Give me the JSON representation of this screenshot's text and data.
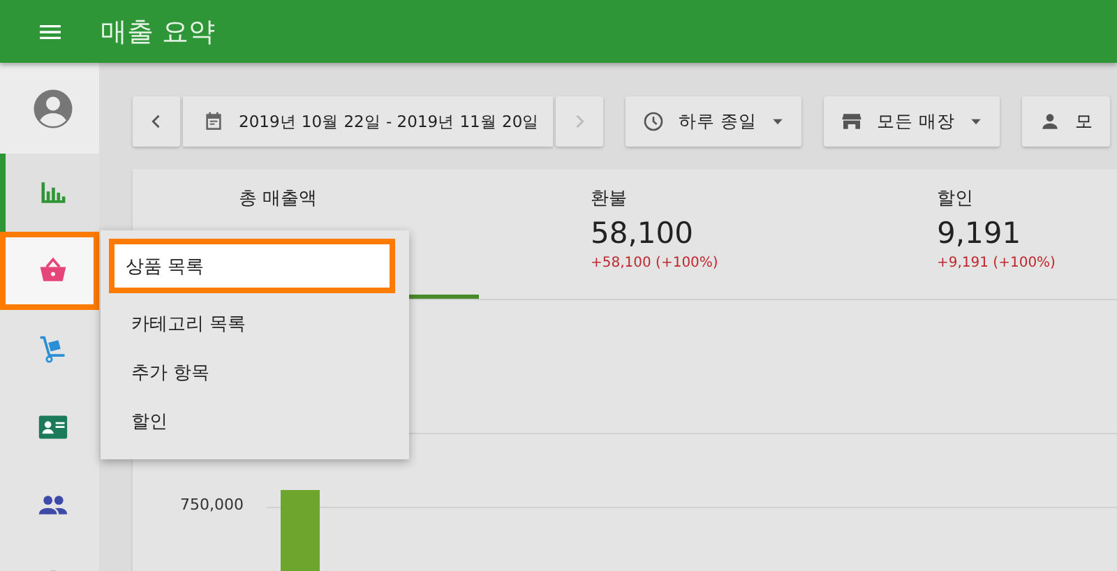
{
  "app_bar": {
    "title": "매출 요약"
  },
  "sidebar": {
    "items": [
      {
        "selected": false,
        "highlighted": false
      },
      {
        "selected": true,
        "highlighted": false
      },
      {
        "selected": false,
        "highlighted": true
      },
      {
        "selected": false,
        "highlighted": false
      },
      {
        "selected": false,
        "highlighted": false
      },
      {
        "selected": false,
        "highlighted": false
      },
      {
        "selected": false,
        "highlighted": false
      }
    ]
  },
  "toolbar": {
    "date_range": "2019년 10월 22일 - 2019년 11월 20일",
    "next_disabled": true,
    "filters": [
      {
        "label": "하루 종일"
      },
      {
        "label": "모든 매장"
      },
      {
        "label": "모"
      }
    ]
  },
  "summary": {
    "stats": [
      {
        "label": "총 매출액",
        "selected": true
      },
      {
        "label": "환불",
        "value": "58,100",
        "change": "+58,100 (+100%)",
        "selected": false
      },
      {
        "label": "할인",
        "value": "9,191",
        "change": "+9,191 (+100%)",
        "selected": false
      }
    ]
  },
  "chart": {
    "tick_label": "750,000"
  },
  "menu": {
    "items": [
      {
        "label": "상품 목록",
        "highlighted": true
      },
      {
        "label": "카테고리 목록",
        "highlighted": false
      },
      {
        "label": "추가 항목",
        "highlighted": false
      },
      {
        "label": "할인",
        "highlighted": false
      }
    ]
  }
}
